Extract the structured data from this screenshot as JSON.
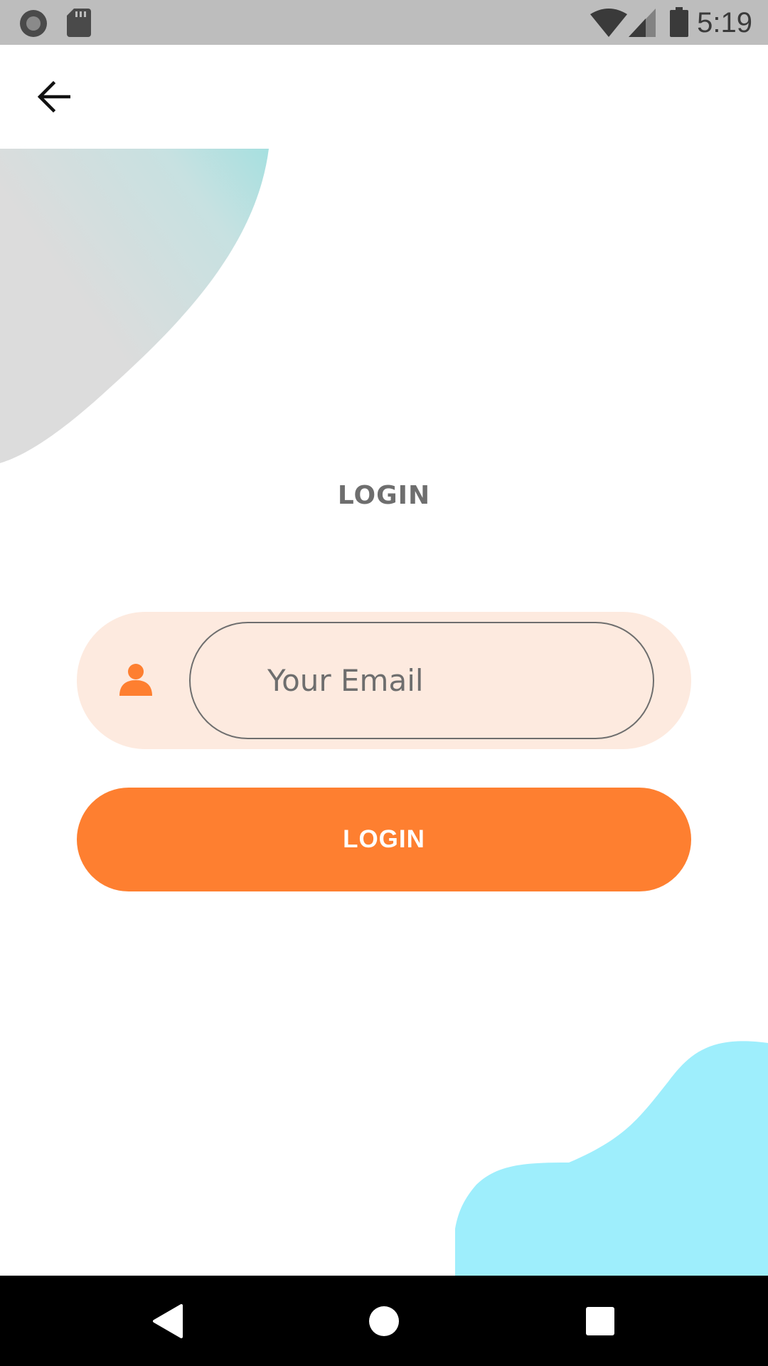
{
  "status_bar": {
    "time": "5:19",
    "left_icons": [
      "record-icon",
      "sd-card-icon"
    ],
    "right_icons": [
      "wifi-icon",
      "cellular-signal-icon",
      "battery-icon"
    ]
  },
  "app_bar": {
    "back_icon": "arrow-back-icon"
  },
  "screen": {
    "title": "LOGIN"
  },
  "form": {
    "email_icon": "person-icon",
    "email_value": "",
    "email_placeholder": "Your Email",
    "login_button_label": "LOGIN"
  },
  "nav_bar": {
    "buttons": [
      "back-triangle-icon",
      "home-circle-icon",
      "recents-square-icon"
    ]
  },
  "colors": {
    "accent": "#fe7f30",
    "input_background": "#fdeadf",
    "text_muted": "#6e6e6e",
    "status_bar": "#bdbdbd",
    "decor_teal": "#a6e0e0",
    "decor_grey": "#dcdcdc",
    "decor_cyan": "#9eeefc"
  }
}
